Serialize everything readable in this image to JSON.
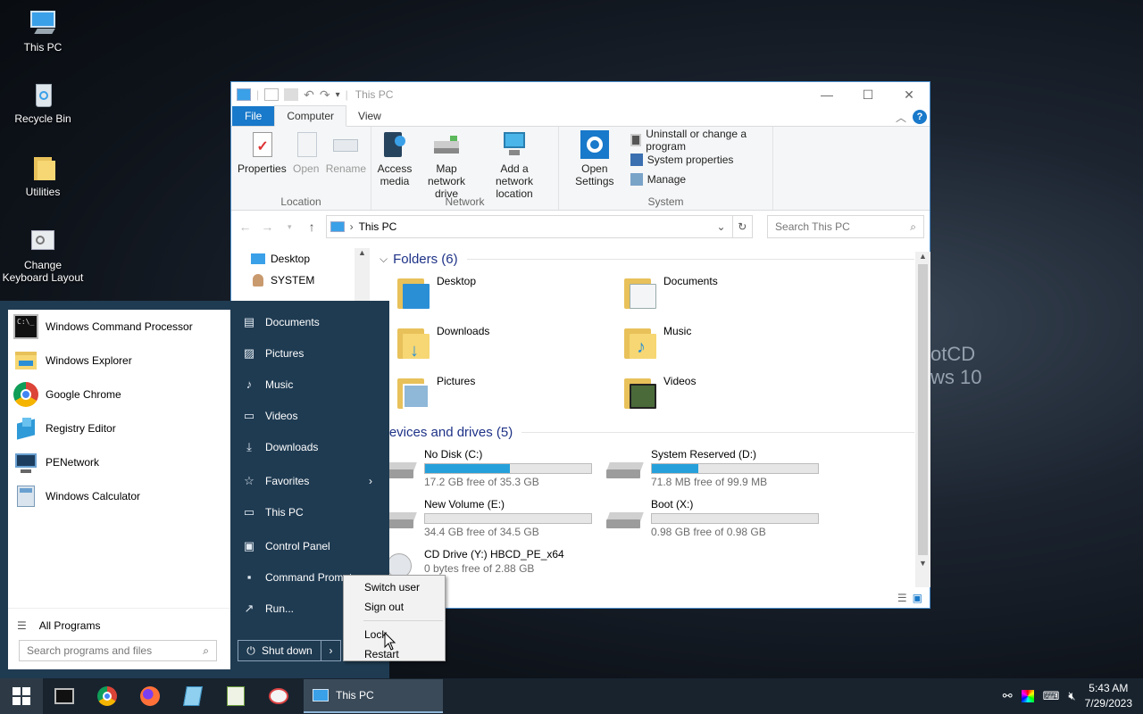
{
  "desktop": {
    "icons": [
      {
        "label": "This PC"
      },
      {
        "label": "Recycle Bin"
      },
      {
        "label": "Utilities"
      },
      {
        "label": "Change Keyboard Layout"
      }
    ],
    "wallpaper_text": [
      "otCD",
      "ws 10"
    ]
  },
  "explorer": {
    "title": "This PC",
    "tabs": {
      "file": "File",
      "computer": "Computer",
      "view": "View"
    },
    "ribbon": {
      "location": {
        "properties": "Properties",
        "open": "Open",
        "rename": "Rename",
        "group": "Location"
      },
      "network": {
        "access_media": "Access media",
        "map_drive": "Map network drive",
        "add_location": "Add a network location",
        "group": "Network"
      },
      "system": {
        "open_settings": "Open Settings",
        "uninstall": "Uninstall or change a program",
        "properties": "System properties",
        "manage": "Manage",
        "group": "System"
      }
    },
    "address": {
      "path": "This PC",
      "search_placeholder": "Search This PC"
    },
    "navpane": [
      {
        "label": "Desktop"
      },
      {
        "label": "SYSTEM"
      }
    ],
    "folders_header": "Folders (6)",
    "folders": [
      {
        "name": "Desktop"
      },
      {
        "name": "Documents"
      },
      {
        "name": "Downloads"
      },
      {
        "name": "Music"
      },
      {
        "name": "Pictures"
      },
      {
        "name": "Videos"
      }
    ],
    "drives_header": "Devices and drives (5)",
    "drives": [
      {
        "name": "No Disk (C:)",
        "free": "17.2 GB free of 35.3 GB",
        "used_fraction": 0.51
      },
      {
        "name": "System Reserved (D:)",
        "free": "71.8 MB free of 99.9 MB",
        "used_fraction": 0.28
      },
      {
        "name": "New Volume (E:)",
        "free": "34.4 GB free of 34.5 GB",
        "used_fraction": 0.0
      },
      {
        "name": "Boot (X:)",
        "free": "0.98 GB free of 0.98 GB",
        "used_fraction": 0.0
      },
      {
        "name": "CD Drive (Y:) HBCD_PE_x64",
        "free": "0 bytes free of 2.88 GB"
      }
    ]
  },
  "startmenu": {
    "programs": [
      {
        "label": "Windows Command Processor"
      },
      {
        "label": "Windows Explorer"
      },
      {
        "label": "Google Chrome"
      },
      {
        "label": "Registry Editor"
      },
      {
        "label": "PENetwork"
      },
      {
        "label": "Windows Calculator"
      }
    ],
    "all_programs": "All Programs",
    "search_placeholder": "Search programs and files",
    "right": [
      {
        "label": "Documents"
      },
      {
        "label": "Pictures"
      },
      {
        "label": "Music"
      },
      {
        "label": "Videos"
      },
      {
        "label": "Downloads"
      },
      {
        "label": "Favorites"
      },
      {
        "label": "This PC"
      },
      {
        "label": "Control Panel"
      },
      {
        "label": "Command Prompt"
      },
      {
        "label": "Run..."
      }
    ],
    "shutdown": "Shut down"
  },
  "context_menu": {
    "items": [
      "Switch user",
      "Sign out",
      "Lock",
      "Restart"
    ]
  },
  "taskbar": {
    "window": "This PC",
    "time": "5:43 AM",
    "date": "7/29/2023"
  },
  "colors": {
    "accent": "#1979ca",
    "start_bg": "#1f3b52",
    "bar_fill": "#26a0da",
    "folder": "#f6d773"
  }
}
